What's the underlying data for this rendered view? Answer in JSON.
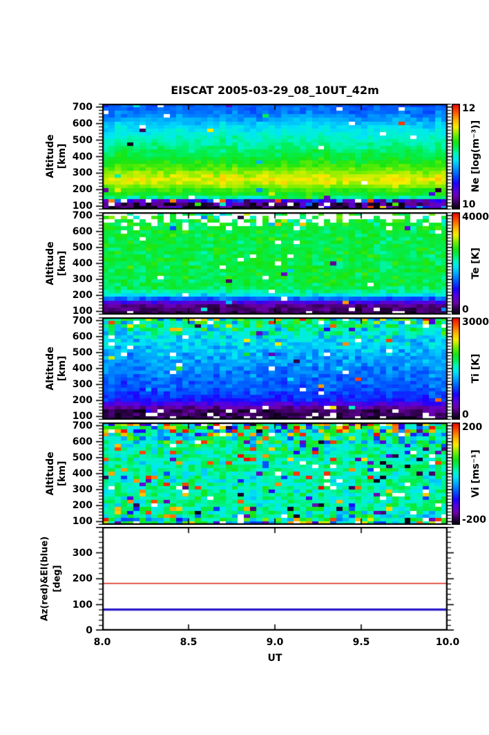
{
  "title": "EISCAT 2005-03-29_08_10UT_42m",
  "axes": {
    "x": {
      "label": "UT",
      "range": [
        8.0,
        10.0
      ],
      "major_ticks": [
        8.5,
        9.0,
        9.5
      ],
      "tick_label_values": [
        8.0,
        8.5,
        9.0,
        9.5,
        10.0
      ],
      "tick_labels": [
        "8.0",
        "8.5",
        "9.0",
        "9.5",
        "10.0"
      ]
    },
    "altitude": {
      "label_line1": "Altitude",
      "label_line2": "[km]",
      "range": [
        80,
        720
      ],
      "major_ticks": [
        100,
        200,
        300,
        400,
        500,
        600,
        700
      ],
      "tick_labels": [
        "100",
        "200",
        "300",
        "400",
        "500",
        "600",
        "700"
      ],
      "minor_step": 20
    },
    "azel": {
      "label_line1": "Az(red)&El(blue)",
      "label_line2": "[deg]",
      "range": [
        0,
        400
      ],
      "major_ticks": [
        0,
        100,
        200,
        300
      ],
      "tick_labels": [
        "0",
        "100",
        "200",
        "300"
      ],
      "minor_step": 20
    }
  },
  "colorbars": [
    {
      "title": "Ne [log(m⁻³)]",
      "max_label": "12",
      "min_label": "10"
    },
    {
      "title": "Te [K]",
      "max_label": "4000",
      "min_label": "0"
    },
    {
      "title": "Ti [K]",
      "max_label": "3000",
      "min_label": "0"
    },
    {
      "title": "Vi [ms⁻¹]",
      "max_label": "200",
      "min_label": "-200"
    }
  ],
  "chart_data": {
    "type": "heatmap",
    "description": "EISCAT incoherent-scatter radar summary plot, 5 stacked panels vs UT (8.0-10.0) and altitude (80-720 km)",
    "x_range_ut": [
      8.0,
      10.0
    ],
    "altitude_range_km": [
      80,
      720
    ],
    "columns": 56,
    "colormap_stops": [
      [
        0.0,
        "#000008"
      ],
      [
        0.05,
        "#26003e"
      ],
      [
        0.12,
        "#6c00aa"
      ],
      [
        0.18,
        "#5a00dc"
      ],
      [
        0.25,
        "#1e00ff"
      ],
      [
        0.32,
        "#0050ff"
      ],
      [
        0.4,
        "#00a2ff"
      ],
      [
        0.47,
        "#00e6f6"
      ],
      [
        0.53,
        "#00f6bc"
      ],
      [
        0.58,
        "#00f05e"
      ],
      [
        0.64,
        "#14e614"
      ],
      [
        0.71,
        "#76ee00"
      ],
      [
        0.78,
        "#f6ee00"
      ],
      [
        0.85,
        "#ffb200"
      ],
      [
        0.92,
        "#ff5800"
      ],
      [
        1.0,
        "#ee0000"
      ]
    ],
    "panels": [
      {
        "id": "ne",
        "quantity": "Ne",
        "units": "log(m⁻³)",
        "scale": [
          10,
          12
        ],
        "profile": [
          [
            720,
            0.32
          ],
          [
            650,
            0.37
          ],
          [
            600,
            0.44
          ],
          [
            550,
            0.49
          ],
          [
            500,
            0.53
          ],
          [
            450,
            0.57
          ],
          [
            400,
            0.61
          ],
          [
            350,
            0.66
          ],
          [
            320,
            0.7
          ],
          [
            290,
            0.75
          ],
          [
            260,
            0.78
          ],
          [
            230,
            0.74
          ],
          [
            200,
            0.67
          ],
          [
            170,
            0.63
          ],
          [
            152,
            0.56
          ],
          [
            140,
            0.38
          ],
          [
            128,
            0.1
          ],
          [
            80,
            0.05
          ]
        ],
        "sigma": [
          [
            720,
            0.035
          ],
          [
            160,
            0.03
          ],
          [
            145,
            0.1
          ],
          [
            120,
            0.16
          ],
          [
            80,
            0.14
          ]
        ],
        "outlier_p": [
          [
            720,
            0.012
          ],
          [
            150,
            0.012
          ],
          [
            130,
            0.1
          ],
          [
            80,
            0.14
          ]
        ],
        "missing_p": [
          [
            720,
            0.03
          ],
          [
            665,
            0.02
          ],
          [
            650,
            0.004
          ],
          [
            145,
            0.004
          ],
          [
            125,
            0.05
          ],
          [
            80,
            0.07
          ]
        ]
      },
      {
        "id": "te",
        "quantity": "Te",
        "units": "K",
        "scale": [
          0,
          4000
        ],
        "profile": [
          [
            720,
            0.61
          ],
          [
            260,
            0.6
          ],
          [
            230,
            0.56
          ],
          [
            205,
            0.49
          ],
          [
            185,
            0.37
          ],
          [
            168,
            0.27
          ],
          [
            152,
            0.17
          ],
          [
            135,
            0.1
          ],
          [
            80,
            0.06
          ]
        ],
        "sigma": [
          [
            720,
            0.12
          ],
          [
            655,
            0.09
          ],
          [
            620,
            0.055
          ],
          [
            200,
            0.05
          ],
          [
            150,
            0.035
          ],
          [
            80,
            0.04
          ]
        ],
        "outlier_p": [
          [
            720,
            0.09
          ],
          [
            650,
            0.05
          ],
          [
            600,
            0.015
          ],
          [
            80,
            0.008
          ]
        ],
        "missing_p": [
          [
            720,
            0.62
          ],
          [
            685,
            0.45
          ],
          [
            655,
            0.22
          ],
          [
            615,
            0.08
          ],
          [
            585,
            0.02
          ],
          [
            135,
            0.012
          ],
          [
            110,
            0.05
          ],
          [
            80,
            0.06
          ]
        ]
      },
      {
        "id": "ti",
        "quantity": "Ti",
        "units": "K",
        "scale": [
          0,
          3000
        ],
        "profile": [
          [
            720,
            0.6
          ],
          [
            680,
            0.56
          ],
          [
            650,
            0.53
          ],
          [
            600,
            0.49
          ],
          [
            560,
            0.46
          ],
          [
            500,
            0.43
          ],
          [
            440,
            0.4
          ],
          [
            380,
            0.37
          ],
          [
            300,
            0.34
          ],
          [
            240,
            0.31
          ],
          [
            205,
            0.28
          ],
          [
            180,
            0.2
          ],
          [
            160,
            0.13
          ],
          [
            140,
            0.08
          ],
          [
            80,
            0.05
          ]
        ],
        "sigma": [
          [
            720,
            0.2
          ],
          [
            660,
            0.14
          ],
          [
            620,
            0.09
          ],
          [
            560,
            0.07
          ],
          [
            400,
            0.05
          ],
          [
            200,
            0.04
          ],
          [
            80,
            0.05
          ]
        ],
        "outlier_p": [
          [
            720,
            0.16
          ],
          [
            650,
            0.08
          ],
          [
            600,
            0.025
          ],
          [
            80,
            0.008
          ]
        ],
        "missing_p": [
          [
            720,
            0.1
          ],
          [
            680,
            0.05
          ],
          [
            650,
            0.02
          ],
          [
            140,
            0.01
          ],
          [
            118,
            0.12
          ],
          [
            80,
            0.18
          ]
        ]
      },
      {
        "id": "vi",
        "quantity": "Vi",
        "units": "ms⁻¹",
        "scale": [
          -200,
          200
        ],
        "outlier_mode": "extreme",
        "profile": [
          [
            720,
            0.54
          ],
          [
            80,
            0.54
          ]
        ],
        "sigma": [
          [
            720,
            0.3
          ],
          [
            640,
            0.22
          ],
          [
            600,
            0.14
          ],
          [
            560,
            0.1
          ],
          [
            500,
            0.08
          ],
          [
            170,
            0.08
          ],
          [
            130,
            0.16
          ],
          [
            80,
            0.22
          ]
        ],
        "outlier_p": [
          [
            720,
            0.3
          ],
          [
            640,
            0.18
          ],
          [
            560,
            0.1
          ],
          [
            200,
            0.08
          ],
          [
            130,
            0.14
          ],
          [
            80,
            0.22
          ]
        ],
        "missing_p": [
          [
            720,
            0.07
          ],
          [
            660,
            0.03
          ],
          [
            150,
            0.02
          ],
          [
            112,
            0.08
          ],
          [
            80,
            0.1
          ]
        ]
      },
      {
        "id": "azel",
        "type": "lines",
        "y_range_deg": [
          0,
          400
        ],
        "lines": [
          {
            "name": "Az",
            "value_deg": 182,
            "color": "#dd2f1e",
            "width": 1.6
          },
          {
            "name": "El",
            "value_deg": 81,
            "color": "#2818c8",
            "width": 3.2
          }
        ]
      }
    ]
  }
}
